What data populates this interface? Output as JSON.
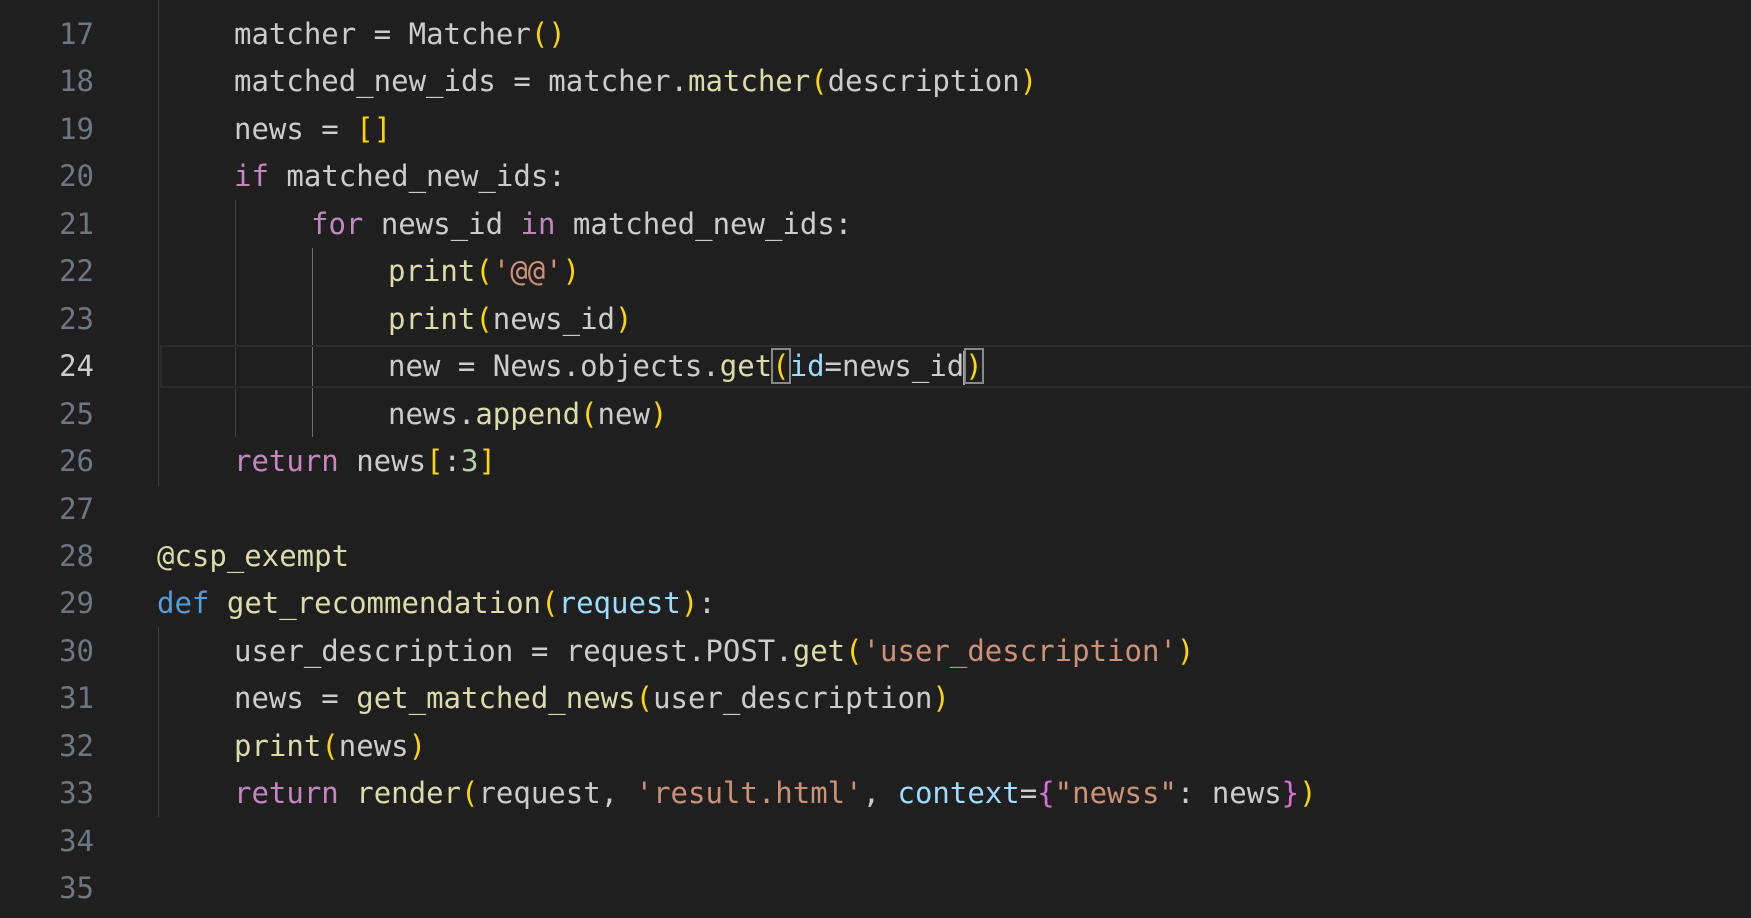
{
  "editor": {
    "active_line": "24",
    "line_numbers": [
      "17",
      "18",
      "19",
      "20",
      "21",
      "22",
      "23",
      "24",
      "25",
      "26",
      "27",
      "28",
      "29",
      "30",
      "31",
      "32",
      "33",
      "34",
      "35"
    ],
    "lines": {
      "l17": {
        "var": "matcher",
        "op": " = ",
        "cls": "Matcher",
        "open": "(",
        "close": ")"
      },
      "l18": {
        "var": "matched_new_ids",
        "op": " = ",
        "obj": "matcher",
        "dot": ".",
        "fn": "matcher",
        "open": "(",
        "arg": "description",
        "close": ")"
      },
      "l19": {
        "var": "news",
        "op": " = ",
        "brk": "[]"
      },
      "l20": {
        "kw": "if",
        "cond": " matched_new_ids:"
      },
      "l21": {
        "kw_for": "for",
        "var": " news_id ",
        "kw_in": "in",
        "rest": " matched_new_ids:"
      },
      "l22": {
        "fn": "print",
        "open": "(",
        "str": "'@@'",
        "close": ")"
      },
      "l23": {
        "fn": "print",
        "open": "(",
        "arg": "news_id",
        "close": ")"
      },
      "l24": {
        "var": "new",
        "op": " = ",
        "obj": "News.objects.",
        "fn": "get",
        "open": "(",
        "param": "id",
        "eq": "=",
        "arg": "news_id",
        "close": ")"
      },
      "l25": {
        "obj": "news.",
        "fn": "append",
        "open": "(",
        "arg": "new",
        "close": ")"
      },
      "l26": {
        "kw": "return",
        "var": " news",
        "open": "[",
        "colon": ":",
        "num": "3",
        "close": "]"
      },
      "l28": {
        "decorator": "@csp_exempt"
      },
      "l29": {
        "kw": "def",
        "fn": "get_recommendation",
        "open": "(",
        "param": "request",
        "close": ")",
        "colon": ":"
      },
      "l30": {
        "var": "user_description",
        "op": " = ",
        "obj": "request.POST.",
        "fn": "get",
        "open": "(",
        "str": "'user_description'",
        "close": ")"
      },
      "l31": {
        "var": "news",
        "op": " = ",
        "fn": "get_matched_news",
        "open": "(",
        "arg": "user_description",
        "close": ")"
      },
      "l32": {
        "fn": "print",
        "open": "(",
        "arg": "news",
        "close": ")"
      },
      "l33": {
        "kw": "return",
        "fn": "render",
        "open": "(",
        "arg1": "request, ",
        "str1": "'result.html'",
        "comma": ", ",
        "param": "context",
        "eq": "=",
        "brace_open": "{",
        "str2": "\"newss\"",
        "colon": ": ",
        "arg2": "news",
        "brace_close": "}",
        "close": ")"
      }
    }
  },
  "colors": {
    "background": "#1f1f1f",
    "keyword": "#c586c0",
    "def_keyword": "#569cd6",
    "function": "#dcdcaa",
    "parameter": "#9cdcfe",
    "string": "#ce9178",
    "number": "#b5cea8",
    "bracket_level1": "#ffd700",
    "bracket_level2": "#da70d6"
  }
}
